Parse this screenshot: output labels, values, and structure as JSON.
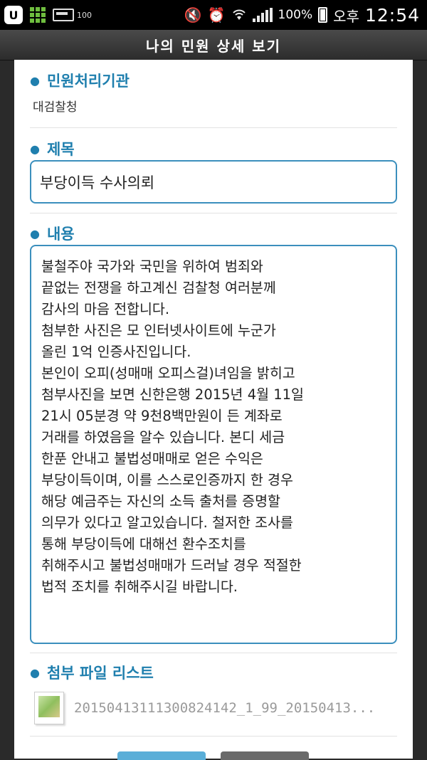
{
  "status_bar": {
    "badge": "U",
    "battery_small_text": "100",
    "battery_percent": "100%",
    "ampm": "오후",
    "time": "12:54"
  },
  "title_bar": {
    "title": "나의 민원 상세 보기"
  },
  "sections": {
    "agency": {
      "label": "민원처리기관",
      "value": "대검찰청"
    },
    "subject": {
      "label": "제목",
      "value": "부당이득 수사의뢰"
    },
    "content": {
      "label": "내용",
      "value": "불철주야 국가와 국민을 위하여 범죄와\n끝없는 전쟁을 하고계신 검찰청 여러분께\n감사의 마음 전합니다.\n첨부한 사진은 모 인터넷사이트에 누군가\n올린 1억 인증사진입니다.\n본인이 오피(성매매 오피스걸)녀임을 밝히고\n첨부사진을 보면 신한은행 2015년 4월 11일\n21시 05분경 약 9천8백만원이 든 계좌로\n거래를 하였음을 알수 있습니다. 본디 세금\n한푼 안내고 불법성매매로 얻은 수익은\n부당이득이며, 이를 스스로인증까지 한 경우\n해당 예금주는 자신의 소득 출처를 증명할\n의무가 있다고 알고있습니다. 철저한 조사를\n통해 부당이득에 대해선 환수조치를\n취해주시고 불법성매매가 드러날 경우 적절한\n법적 조치를 취해주시길 바랍니다."
    },
    "attachments": {
      "label": "첨부 파일 리스트",
      "files": [
        {
          "name": "20150413111300824142_1_99_20150413..."
        }
      ]
    }
  },
  "colors": {
    "accent": "#1f7fae",
    "border": "#3b8fbd",
    "title_bar": "#3a3a3a"
  }
}
